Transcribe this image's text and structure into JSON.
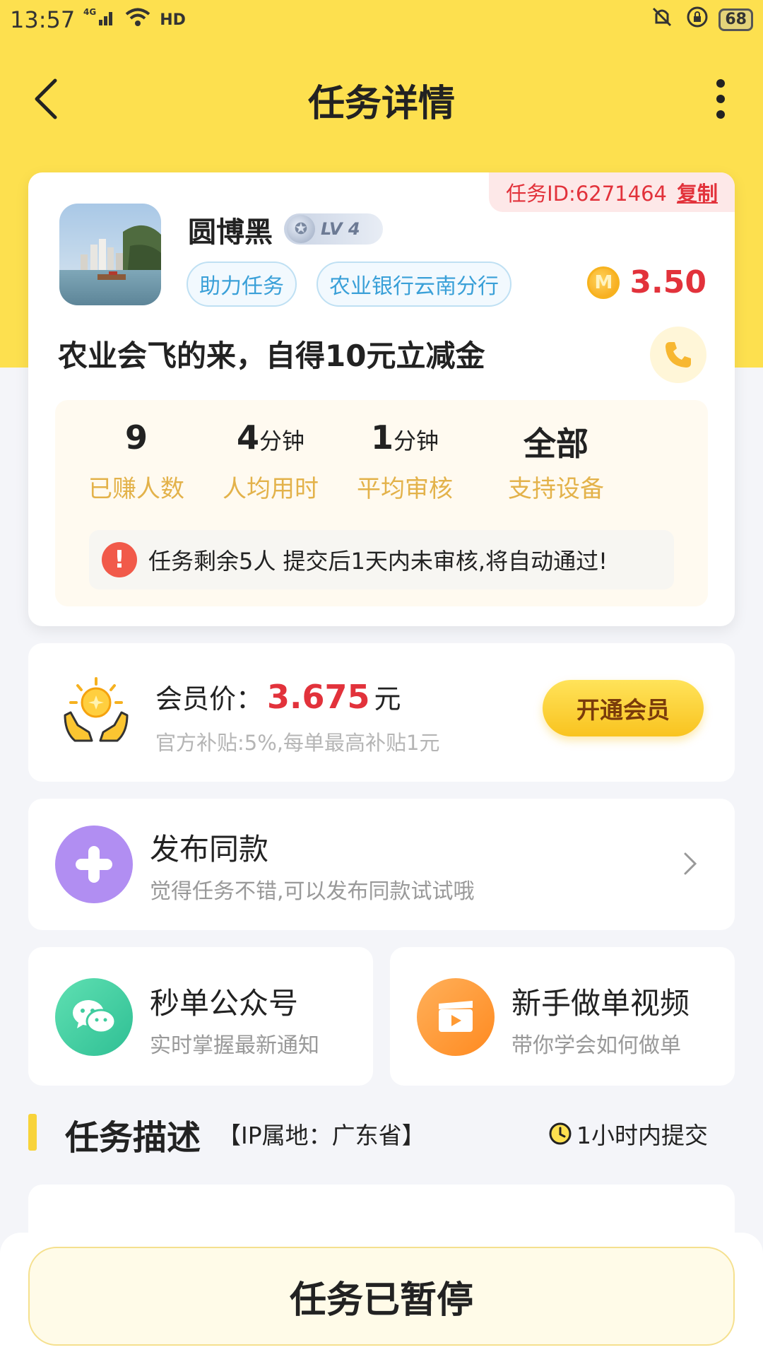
{
  "status_bar": {
    "time": "13:57",
    "network": "4G",
    "hd": "HD",
    "battery": "68"
  },
  "nav": {
    "title": "任务详情"
  },
  "task": {
    "id_label": "任务ID:6271464",
    "copy_label": "复制",
    "publisher": "圆博黑",
    "level": "LV 4",
    "tags": [
      "助力任务",
      "农业银行云南分行"
    ],
    "coin_symbol": "M",
    "reward": "3.50",
    "title": "农业会飞的来，自得10元立减金"
  },
  "stats": [
    {
      "value": "9",
      "unit": "",
      "label": "已赚人数"
    },
    {
      "value": "4",
      "unit": "分钟",
      "label": "人均用时"
    },
    {
      "value": "1",
      "unit": "分钟",
      "label": "平均审核"
    },
    {
      "value": "全部",
      "unit": "",
      "label": "支持设备"
    }
  ],
  "notice": {
    "icon": "!",
    "text": "任务剩余5人  提交后1天内未审核,将自动通过!"
  },
  "member": {
    "label": "会员价：",
    "price": "3.675",
    "unit": "元",
    "subsidy": "官方补贴:5%,每单最高补贴1元",
    "button": "开通会员"
  },
  "publish": {
    "title": "发布同款",
    "subtitle": "觉得任务不错,可以发布同款试试哦"
  },
  "wechat": {
    "title": "秒单公众号",
    "subtitle": "实时掌握最新通知"
  },
  "video": {
    "title": "新手做单视频",
    "subtitle": "带你学会如何做单"
  },
  "description": {
    "title": "任务描述",
    "ip": "【IP属地：广东省】",
    "deadline": "1小时内提交"
  },
  "bottom": {
    "button": "任务已暂停"
  },
  "colors": {
    "brand_yellow": "#fde04f",
    "price_red": "#e2323b",
    "label_gold": "#e3b24a"
  }
}
